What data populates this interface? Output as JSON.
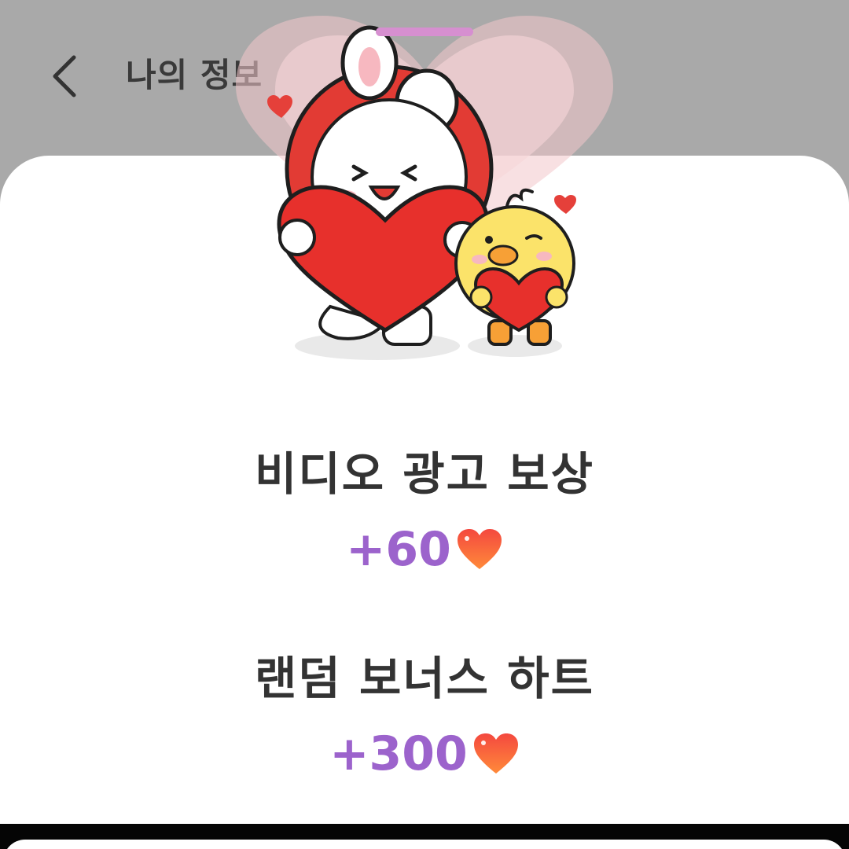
{
  "header": {
    "title": "나의 정보",
    "back_icon": "chevron-left-icon"
  },
  "rewards": [
    {
      "title": "비디오 광고 보상",
      "amount": "+60",
      "icon": "heart-icon"
    },
    {
      "title": "랜덤 보너스 하트",
      "amount": "+300",
      "icon": "heart-icon"
    }
  ],
  "colors": {
    "header_bg": "#a9a9a9",
    "sheet_bg": "#ffffff",
    "accent_purple": "#9c63cc",
    "handle": "#d68fd0",
    "heart_red": "#f0443a"
  }
}
